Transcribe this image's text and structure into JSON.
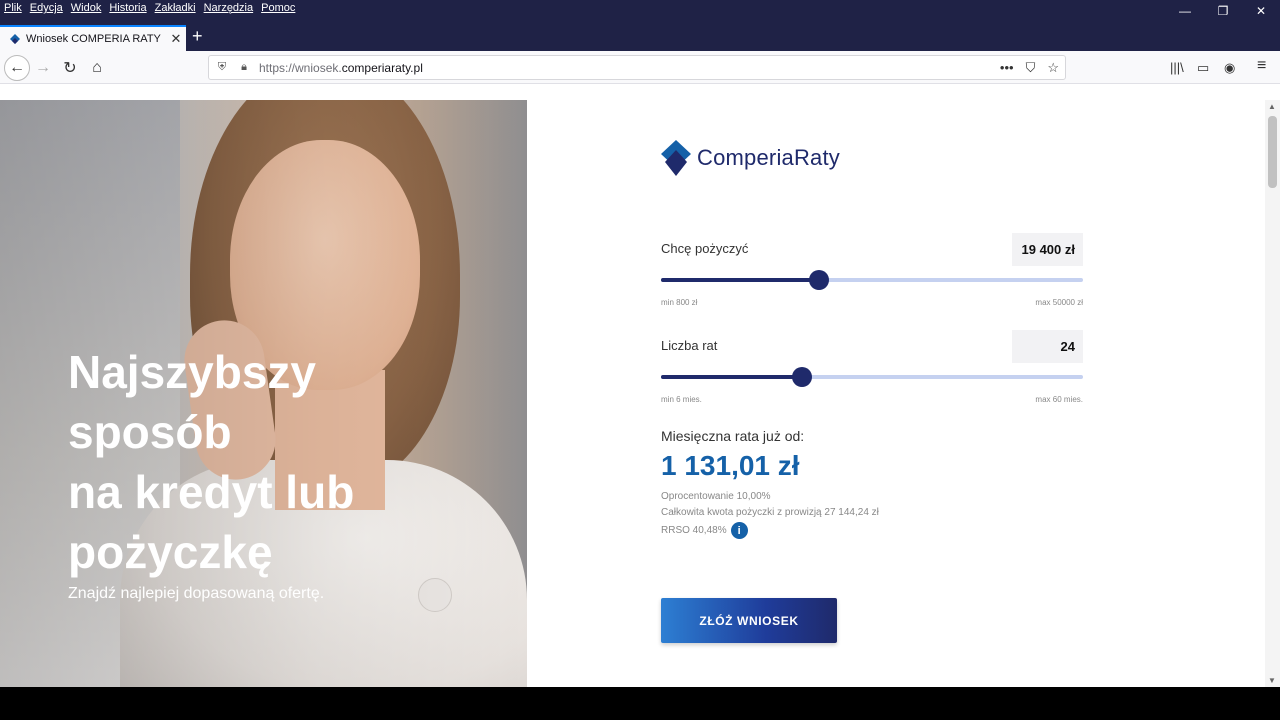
{
  "menu": [
    "Plik",
    "Edycja",
    "Widok",
    "Historia",
    "Zakładki",
    "Narzędzia",
    "Pomoc"
  ],
  "window_controls": {
    "minimize": "—",
    "restore": "❐",
    "close": "✕"
  },
  "tab": {
    "title": "Wniosek COMPERIA RATY",
    "close": "✕",
    "new_tab": "+"
  },
  "nav": {
    "back": "←",
    "forward": "→",
    "reload": "↻",
    "home": "⌂"
  },
  "url": {
    "prefix": "https://wniosek.",
    "host": "comperiaraty.pl",
    "more": "•••",
    "pocket": "⛉",
    "bookmark": "☆"
  },
  "toolbar_right": {
    "library": "|||\\",
    "sidebar": "▭",
    "account": "◉",
    "menu": "≡"
  },
  "hero": {
    "headline_lines": [
      "Najszybszy",
      "sposób",
      "na kredyt lub",
      "pożyczkę"
    ],
    "subtitle": "Znajdź najlepiej dopasowaną ofertę."
  },
  "form": {
    "logo": "ComperiaRaty",
    "amount": {
      "label": "Chcę pożyczyć",
      "value": "19 400 zł",
      "min": "min 800 zł",
      "max": "max 50000 zł",
      "fraction": 0.375
    },
    "installments": {
      "label": "Liczba rat",
      "value": "24",
      "min": "min 6 mies.",
      "max": "max 60 mies.",
      "fraction": 0.333
    },
    "rate_label": "Miesięczna rata już od:",
    "rate_value": "1 131,01 zł",
    "interest": "Oprocentowanie 10,00%",
    "total": "Całkowita kwota pożyczki z prowizją 27 144,24 zł",
    "rrso": "RRSO 40,48%",
    "info_icon": "i",
    "submit": "ZŁÓŻ WNIOSEK"
  },
  "colors": {
    "brand_dark": "#1f2a6b",
    "brand_blue": "#1561a8",
    "track": "#c5d1f0"
  }
}
